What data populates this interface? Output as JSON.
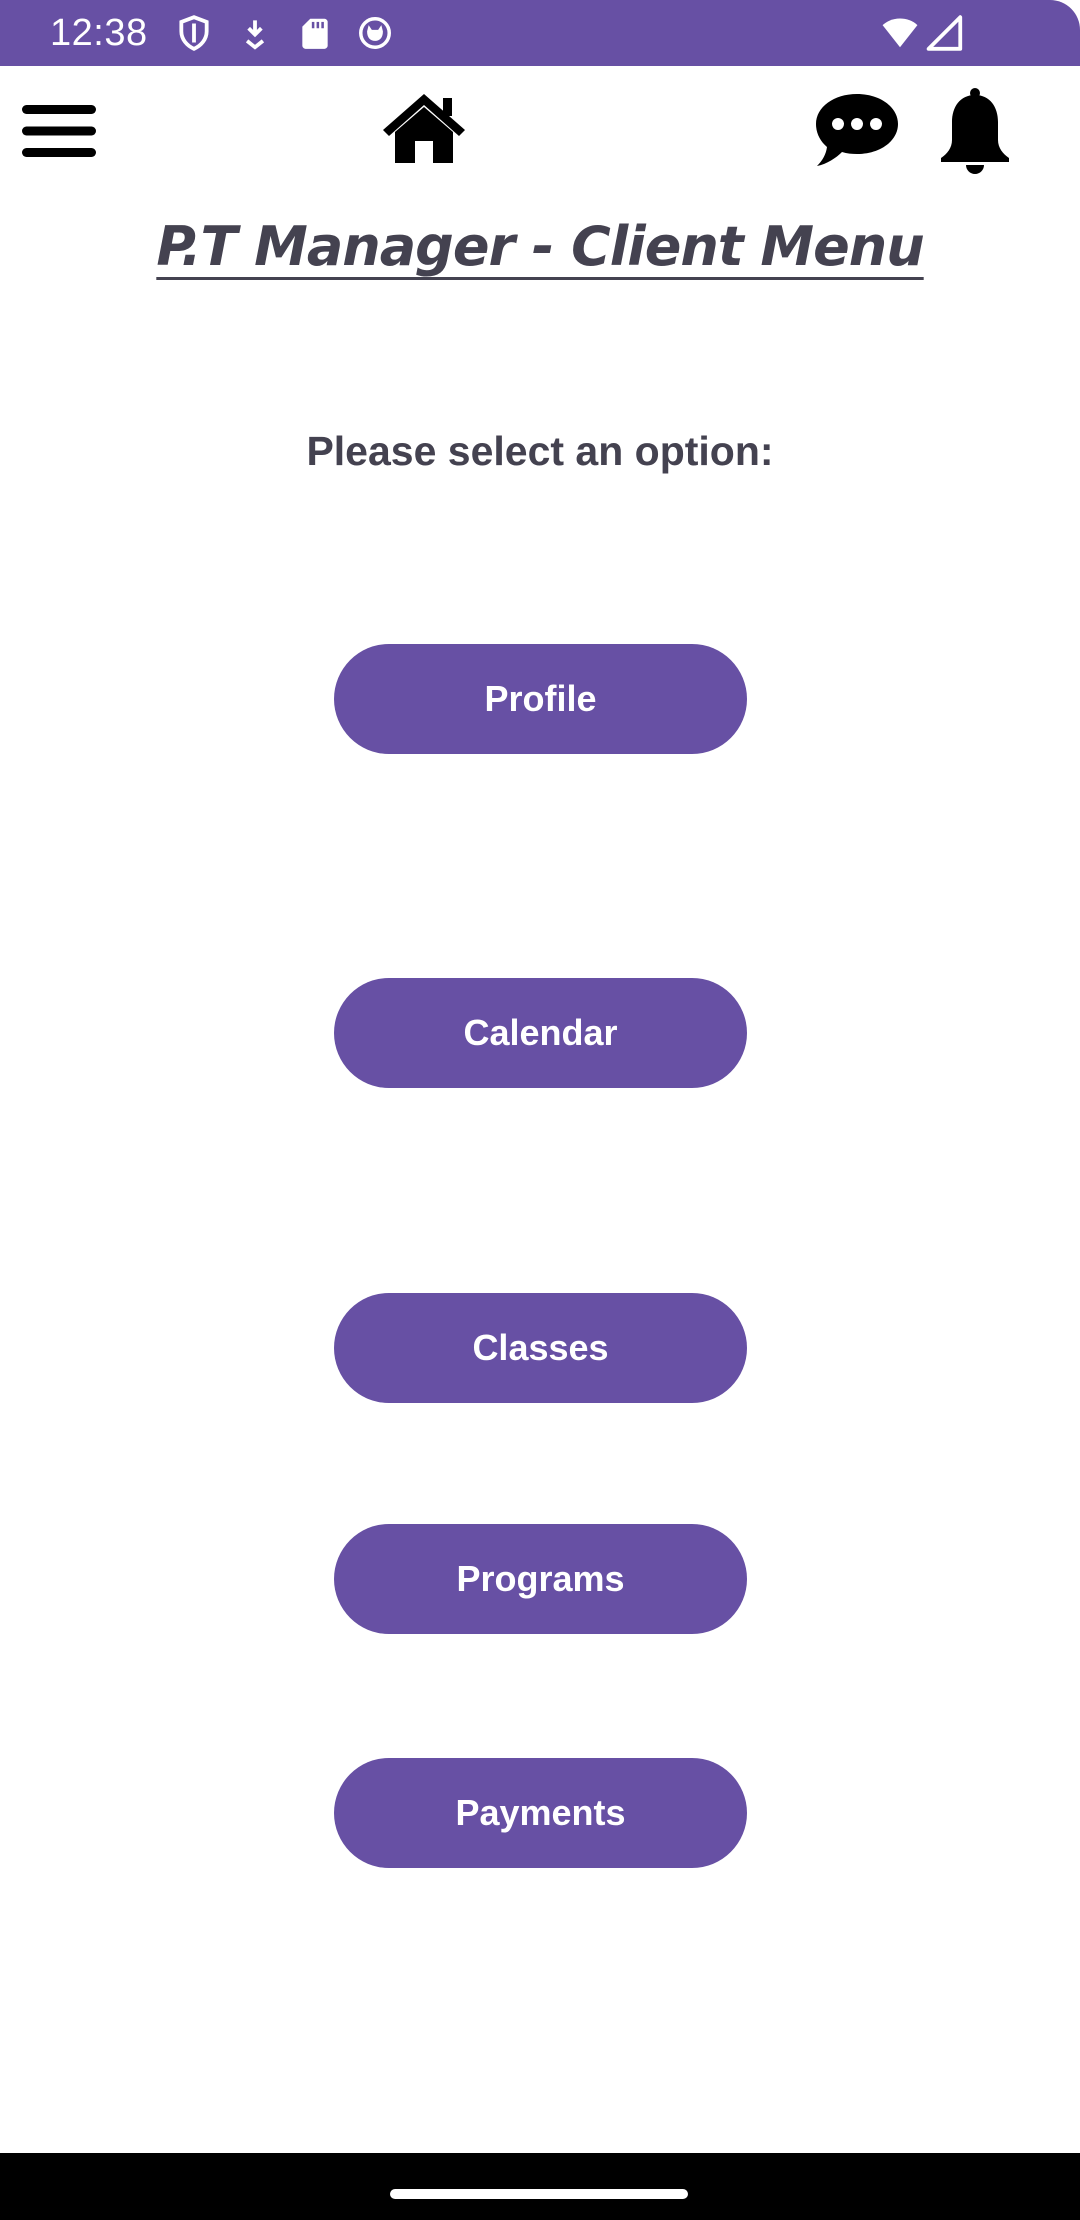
{
  "status_bar": {
    "time": "12:38",
    "color": "#6750a4",
    "icons": [
      "shield-icon",
      "download-icon",
      "sd-card-icon",
      "cat-face-icon",
      "wifi-icon",
      "cell-signal-icon"
    ]
  },
  "toolbar": {
    "menu_icon": "hamburger-menu-icon",
    "home_icon": "home-icon",
    "chat_icon": "chat-bubble-icon",
    "notifications_icon": "bell-icon"
  },
  "page": {
    "title": "P.T Manager - Client Menu",
    "prompt": "Please select an option:"
  },
  "menu": {
    "profile": "Profile",
    "calendar": "Calendar",
    "classes": "Classes",
    "programs": "Programs",
    "payments": "Payments"
  },
  "colors": {
    "accent": "#6750a4",
    "text": "#444250",
    "background": "#ffffff"
  }
}
